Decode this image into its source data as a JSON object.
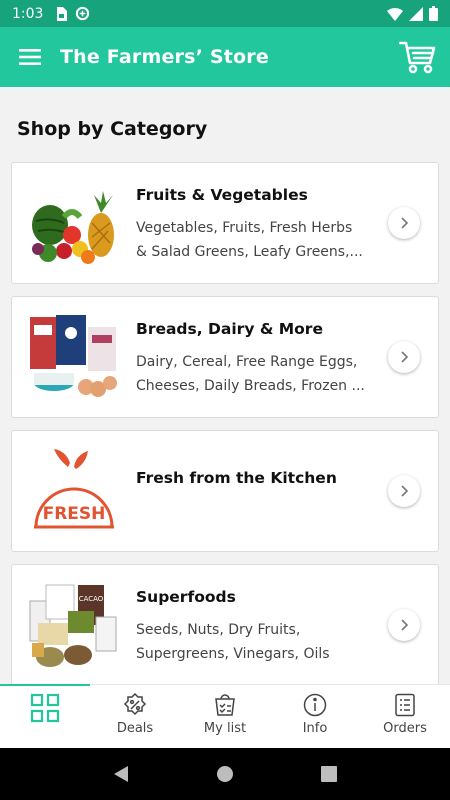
{
  "status_bar": {
    "time": "1:03"
  },
  "app_bar": {
    "title": "The Farmers’ Store"
  },
  "section_title": "Shop by Category",
  "categories": [
    {
      "title": "Fruits & Vegetables",
      "line1": "Vegetables, Fruits, Fresh Herbs",
      "line2": "& Salad Greens, Leafy Greens,..."
    },
    {
      "title": "Breads, Dairy & More",
      "line1": "Dairy, Cereal, Free Range Eggs,",
      "line2": "Cheeses, Daily Breads, Frozen ..."
    },
    {
      "title": "Fresh from the Kitchen",
      "logo_text": "FRESH"
    },
    {
      "title": "Superfoods",
      "line1": "Seeds, Nuts, Dry Fruits,",
      "line2": "Supergreens, Vinegars, Oils"
    }
  ],
  "bottom_nav": [
    {
      "label": "",
      "icon": "grid-icon",
      "active": true
    },
    {
      "label": "Deals",
      "icon": "percent-badge-icon"
    },
    {
      "label": "My list",
      "icon": "shopping-list-icon"
    },
    {
      "label": "Info",
      "icon": "info-icon"
    },
    {
      "label": "Orders",
      "icon": "orders-icon"
    }
  ],
  "colors": {
    "primary": "#22c79d",
    "status_bar": "#17a37b",
    "fresh_logo": "#e2532f"
  }
}
